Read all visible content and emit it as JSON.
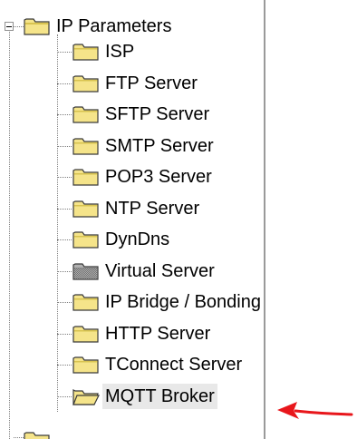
{
  "tree": {
    "root": {
      "label": "IP Parameters",
      "icon": "folder-open-icon",
      "expanded": true
    },
    "children": [
      {
        "label": "ISP",
        "icon": "folder-icon"
      },
      {
        "label": "FTP Server",
        "icon": "folder-icon"
      },
      {
        "label": "SFTP Server",
        "icon": "folder-icon"
      },
      {
        "label": "SMTP Server",
        "icon": "folder-icon"
      },
      {
        "label": "POP3 Server",
        "icon": "folder-icon"
      },
      {
        "label": "NTP Server",
        "icon": "folder-icon"
      },
      {
        "label": "DynDns",
        "icon": "folder-icon"
      },
      {
        "label": "Virtual Server",
        "icon": "folder-gray-icon"
      },
      {
        "label": "IP Bridge / Bonding",
        "icon": "folder-icon"
      },
      {
        "label": "HTTP Server",
        "icon": "folder-icon"
      },
      {
        "label": "TConnect Server",
        "icon": "folder-icon"
      },
      {
        "label": "MQTT Broker",
        "icon": "folder-open-icon",
        "selected": true
      }
    ]
  },
  "colors": {
    "folder_fill": "#f5e48a",
    "folder_edge": "#3a3a3a",
    "folder_gray": "#b0b0b0",
    "arrow": "#e8161b",
    "selection": "#e8e8e8"
  },
  "annotation": {
    "icon": "red-arrow-icon",
    "points_to": "MQTT Broker"
  }
}
